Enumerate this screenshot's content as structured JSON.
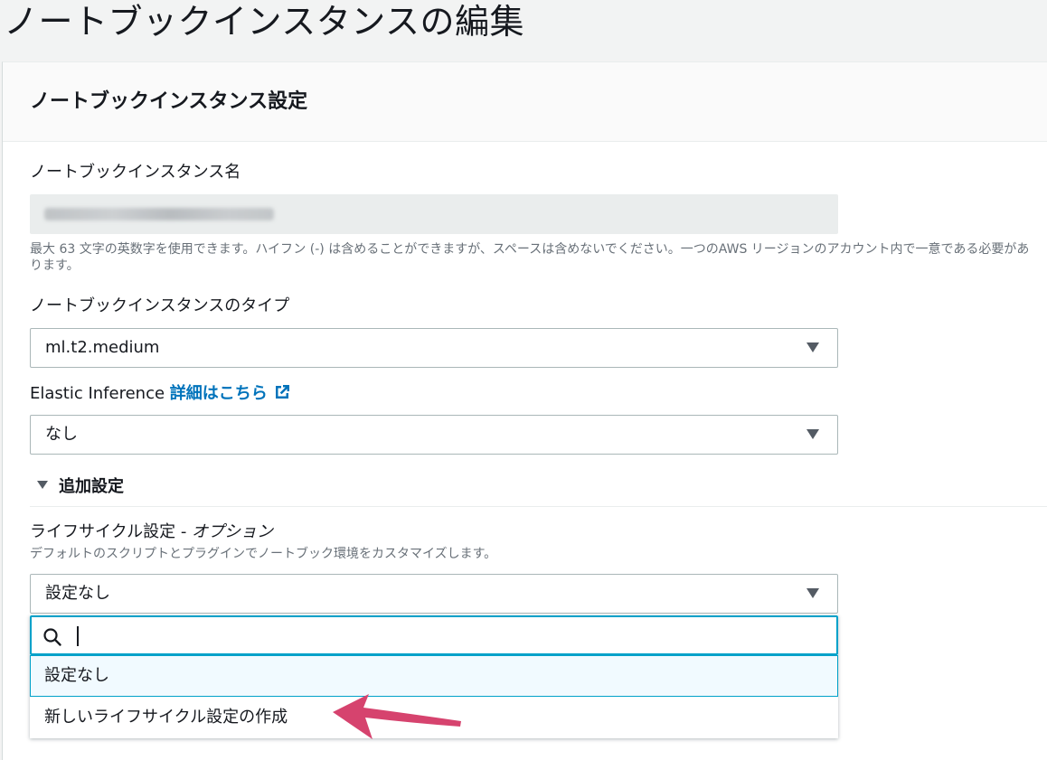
{
  "page": {
    "title": "ノートブックインスタンスの編集"
  },
  "panel": {
    "header": "ノートブックインスタンス設定"
  },
  "fields": {
    "name": {
      "label": "ノートブックインスタンス名",
      "hint": "最大 63 文字の英数字を使用できます。ハイフン (-) は含めることができますが、スペースは含めないでください。一つのAWS リージョンのアカウント内で一意である必要があります。"
    },
    "instance_type": {
      "label": "ノートブックインスタンスのタイプ",
      "value": "ml.t2.medium"
    },
    "elastic_inference": {
      "label": "Elastic Inference",
      "link": "詳細はこちら",
      "value": "なし"
    }
  },
  "additional": {
    "toggle_label": "追加設定",
    "lifecycle": {
      "label": "ライフサイクル設定 - ",
      "label_italic": "オプション",
      "description": "デフォルトのスクリプトとプラグインでノートブック環境をカスタマイズします。",
      "value": "設定なし",
      "search_placeholder": "",
      "options": [
        "設定なし",
        "新しいライフサイクル設定の作成"
      ]
    }
  },
  "colors": {
    "accent": "#00a1c9",
    "link": "#0073bb",
    "annotation_arrow": "#d6436e"
  },
  "icons": [
    "external-link-icon",
    "search-icon",
    "caret-down-icon",
    "annotation-arrow"
  ]
}
